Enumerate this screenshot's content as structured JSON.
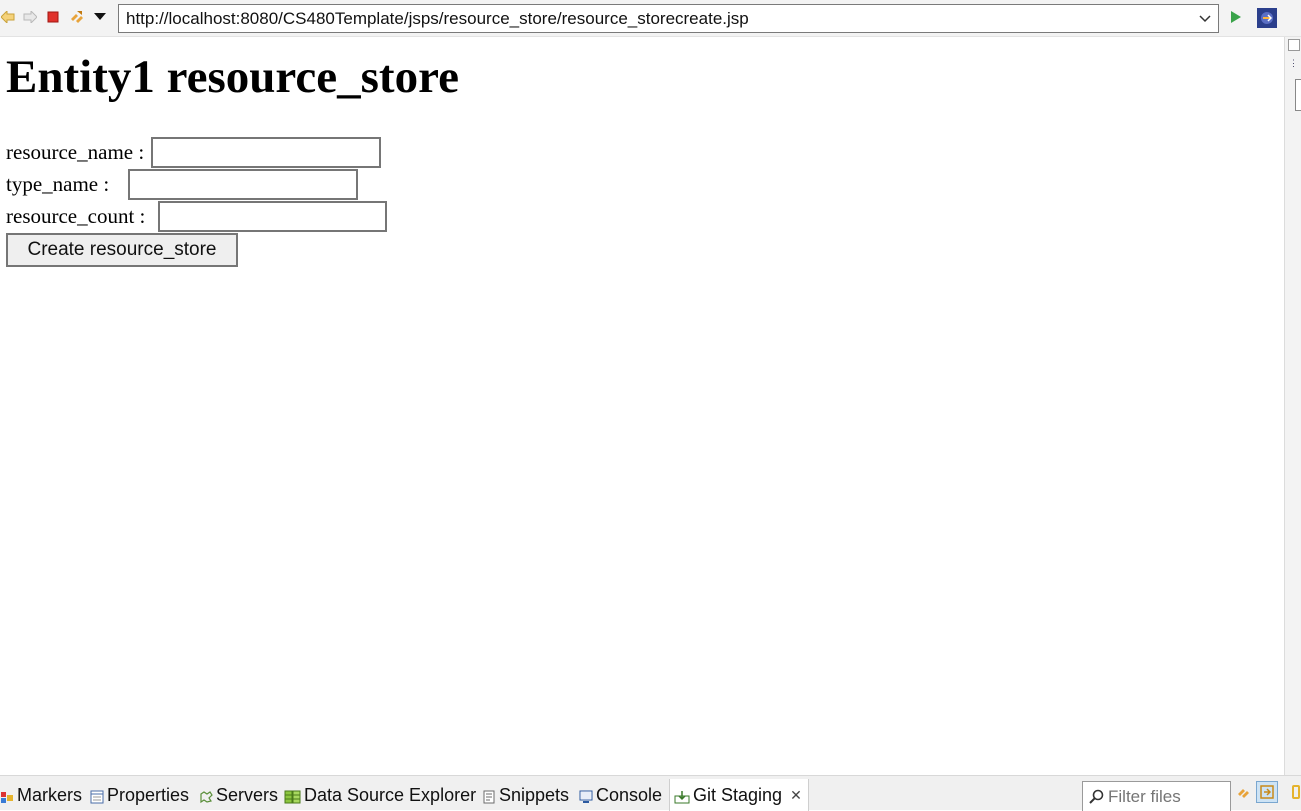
{
  "browser": {
    "url": "http://localhost:8080/CS480Template/jsps/resource_store/resource_storecreate.jsp",
    "toolbar_icons": [
      "back-icon",
      "forward-icon",
      "stop-icon",
      "refresh-icon",
      "menu-dropdown-icon",
      "go-icon",
      "eclipse-icon"
    ]
  },
  "page": {
    "title": "Entity1 resource_store",
    "fields": [
      {
        "label": "resource_name :",
        "value": ""
      },
      {
        "label": "type_name :",
        "value": ""
      },
      {
        "label": "resource_count :",
        "value": ""
      }
    ],
    "submit_label": "Create resource_store"
  },
  "bottom_panel": {
    "tabs": [
      {
        "label": "Markers",
        "icon": "markers-icon"
      },
      {
        "label": "Properties",
        "icon": "properties-icon"
      },
      {
        "label": "Servers",
        "icon": "servers-icon"
      },
      {
        "label": "Data Source Explorer",
        "icon": "data-source-icon"
      },
      {
        "label": "Snippets",
        "icon": "snippets-icon"
      },
      {
        "label": "Console",
        "icon": "console-icon"
      },
      {
        "label": "Git Staging",
        "icon": "git-staging-icon",
        "active": true
      }
    ],
    "close_glyph": "✕",
    "filter_placeholder": "Filter files"
  }
}
